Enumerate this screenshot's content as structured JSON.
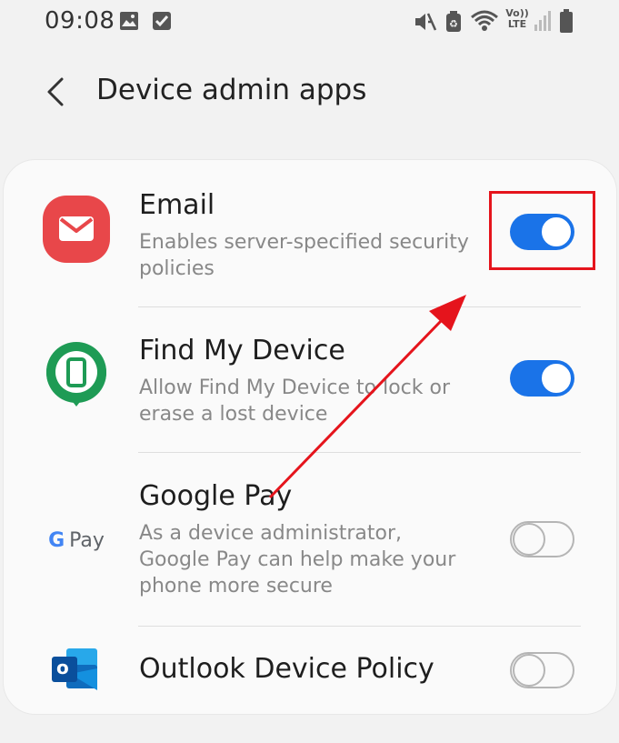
{
  "status_bar": {
    "time": "09:08",
    "left_icons": [
      "image-icon",
      "check-box-icon"
    ],
    "right_icons": [
      "mute-icon",
      "data-saver-icon",
      "wifi-icon",
      "volte-icon",
      "signal-icon",
      "battery-icon"
    ],
    "volte_label_top": "Vo))",
    "volte_label_bottom": "LTE"
  },
  "header": {
    "title": "Device admin apps",
    "back_icon": "chevron-left-icon"
  },
  "apps": [
    {
      "title": "Email",
      "description": "Enables server-specified security policies",
      "enabled": true,
      "icon": "email-app-icon"
    },
    {
      "title": "Find My Device",
      "description": "Allow Find My Device to lock or erase a lost device",
      "enabled": true,
      "icon": "find-my-device-icon"
    },
    {
      "title": "Google Pay",
      "description": "As a device administrator, Google Pay can help make your phone more secure",
      "enabled": false,
      "icon": "google-pay-icon",
      "icon_text_pay": "Pay",
      "icon_text_g": "G"
    },
    {
      "title": "Outlook Device Policy",
      "description": "",
      "enabled": false,
      "icon": "outlook-icon",
      "icon_text": "o"
    }
  ],
  "colors": {
    "toggle_on": "#1a73e8",
    "annotation": "#e5141c",
    "email_icon": "#e8474a",
    "find_my_device_icon": "#1e9b55",
    "outlook_icon": "#0f6cbd"
  },
  "annotation": {
    "type": "highlight-with-arrow",
    "target": "email-toggle"
  }
}
